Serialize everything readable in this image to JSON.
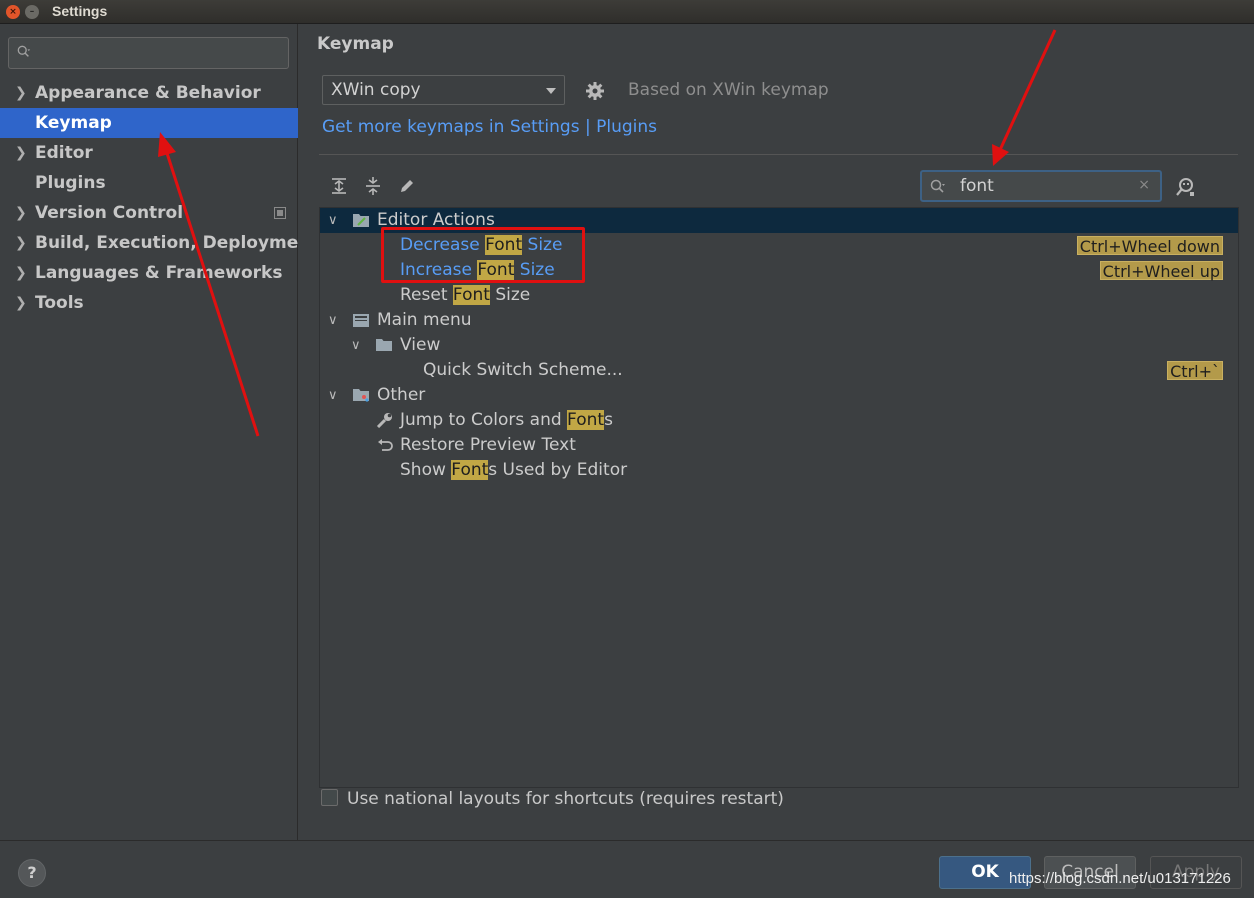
{
  "window": {
    "title": "Settings",
    "close_glyph": "×",
    "min_glyph": "–"
  },
  "sidebar": {
    "search_placeholder": "",
    "items": [
      {
        "label": "Appearance & Behavior",
        "expandable": true
      },
      {
        "label": "Keymap",
        "expandable": false,
        "selected": true
      },
      {
        "label": "Editor",
        "expandable": true
      },
      {
        "label": "Plugins",
        "expandable": false
      },
      {
        "label": "Version Control",
        "expandable": true
      },
      {
        "label": "Build, Execution, Deployment",
        "expandable": true
      },
      {
        "label": "Languages & Frameworks",
        "expandable": true
      },
      {
        "label": "Tools",
        "expandable": true
      }
    ]
  },
  "main": {
    "title": "Keymap",
    "keymap_select": {
      "value": "XWin copy"
    },
    "based_on": "Based on XWin keymap",
    "get_more_link": "Get more keymaps in Settings | Plugins",
    "search": {
      "value": "font",
      "clear_glyph": "×"
    },
    "tree": {
      "editor_actions": {
        "label": "Editor Actions",
        "items": [
          {
            "pre": "Decrease ",
            "hl": "Font",
            "post": " Size",
            "shortcut": "Ctrl+Wheel down"
          },
          {
            "pre": "Increase ",
            "hl": "Font",
            "post": " Size",
            "shortcut": "Ctrl+Wheel up"
          },
          {
            "pre": "Reset ",
            "hl": "Font",
            "post": " Size",
            "shortcut": ""
          }
        ]
      },
      "main_menu": {
        "label": "Main menu",
        "view": {
          "label": "View",
          "items": [
            {
              "label": "Quick Switch Scheme...",
              "shortcut": "Ctrl+`"
            }
          ]
        }
      },
      "other": {
        "label": "Other",
        "items": [
          {
            "pre": "Jump to Colors and ",
            "hl": "Font",
            "post": "s"
          },
          {
            "pre": "Restore Preview Text",
            "hl": "",
            "post": ""
          },
          {
            "pre": "Show ",
            "hl": "Font",
            "post": "s Used by Editor"
          }
        ]
      }
    },
    "national_layouts_label": "Use national layouts for shortcuts (requires restart)"
  },
  "footer": {
    "help": "?",
    "ok": "OK",
    "cancel": "Cancel",
    "apply": "Apply",
    "watermark": "https://blog.csdn.net/u013171226"
  },
  "colors": {
    "selection": "#2f65ca",
    "link": "#589df6",
    "search_highlight": "#c1a745",
    "annotation_red": "#e01010"
  }
}
